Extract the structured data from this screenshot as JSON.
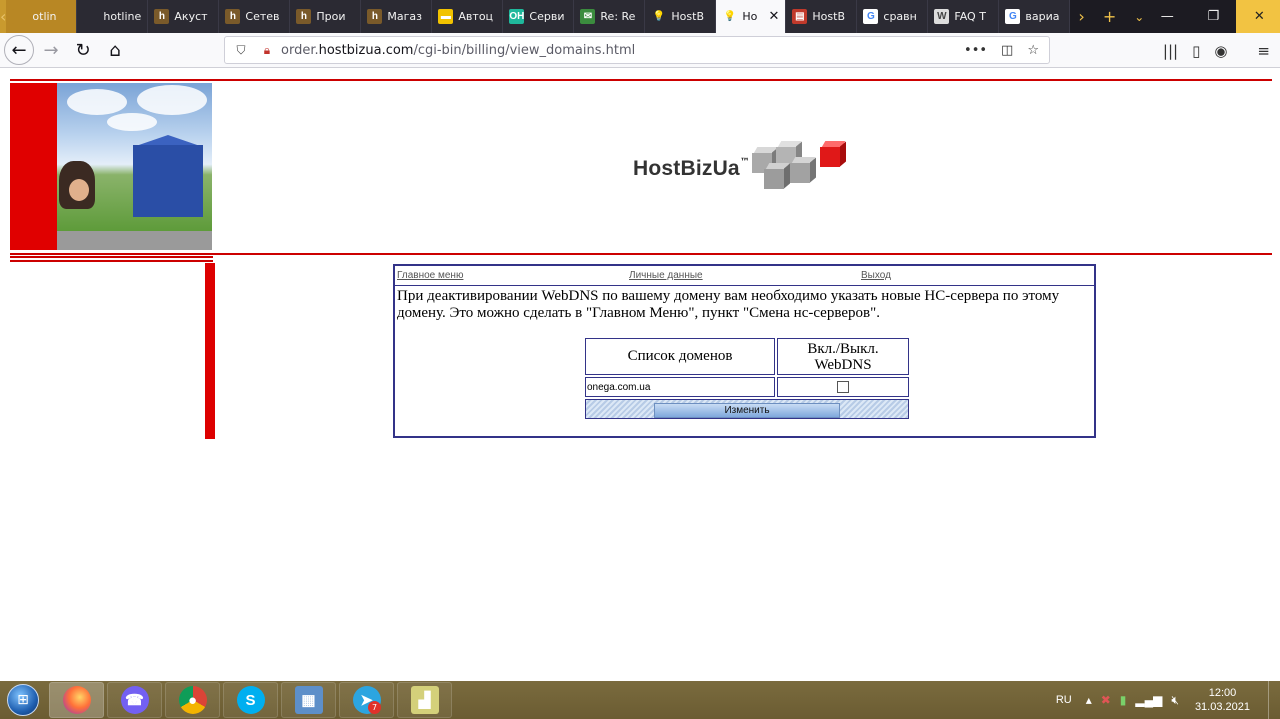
{
  "browser": {
    "tabs": [
      {
        "title": "otlin",
        "favicon": "page-icon",
        "favicon_text": "",
        "favicon_color": "#b88724",
        "style": "yellow"
      },
      {
        "title": "hotline.ua",
        "favicon": "page-icon",
        "favicon_text": "",
        "favicon_color": "#2b2a33",
        "style": "dark"
      },
      {
        "title": "Акуст",
        "favicon": "hotline-icon",
        "favicon_text": "h",
        "favicon_color": "#7a5a2a",
        "style": "dark"
      },
      {
        "title": "Сетев",
        "favicon": "hotline-icon",
        "favicon_text": "h",
        "favicon_color": "#7a5a2a",
        "style": "dark"
      },
      {
        "title": "Прои",
        "favicon": "hotline-icon",
        "favicon_text": "h",
        "favicon_color": "#7a5a2a",
        "style": "dark"
      },
      {
        "title": "Магаз",
        "favicon": "hotline-icon",
        "favicon_text": "h",
        "favicon_color": "#7a5a2a",
        "style": "dark"
      },
      {
        "title": "Автоц",
        "favicon": "auto-icon",
        "favicon_text": "▬",
        "favicon_color": "#f2c300",
        "style": "dark"
      },
      {
        "title": "Серви",
        "favicon": "service-icon",
        "favicon_text": "OH",
        "favicon_color": "#1fb89c",
        "style": "dark"
      },
      {
        "title": "Re: Re",
        "favicon": "mail-icon",
        "favicon_text": "✉",
        "favicon_color": "#3b8c3e",
        "style": "dark"
      },
      {
        "title": "HostB",
        "favicon": "bulb-icon",
        "favicon_text": "💡",
        "favicon_color": "transparent",
        "style": "dark"
      },
      {
        "title": "Ho",
        "favicon": "bulb-icon",
        "favicon_text": "💡",
        "favicon_color": "transparent",
        "style": "active"
      },
      {
        "title": "HostB",
        "favicon": "flag-icon",
        "favicon_text": "▤",
        "favicon_color": "#c0392b",
        "style": "dark"
      },
      {
        "title": "сравн",
        "favicon": "google-icon",
        "favicon_text": "G",
        "favicon_color": "#ffffff",
        "style": "dark"
      },
      {
        "title": "FAQ T",
        "favicon": "wordpress-icon",
        "favicon_text": "W",
        "favicon_color": "#dddddd",
        "style": "dark"
      },
      {
        "title": "вариа",
        "favicon": "google-icon",
        "favicon_text": "G",
        "favicon_color": "#ffffff",
        "style": "dark"
      }
    ],
    "url_host_prefix": "order.",
    "url_host": "hostbizua.com",
    "url_path": "/cgi-bin/billing/view_domains.html",
    "url_more": "•••"
  },
  "logo": {
    "text": "HostBizUa",
    "tm": "™"
  },
  "menu": {
    "main": "Главное меню",
    "personal": "Личные данные",
    "logout": "Выход"
  },
  "notice": "При деактивировании WebDNS по вашему домену вам необходимо указать новые НС-сервера по этому домену. Это можно сделать в \"Главном Меню\", пункт \"Смена нс-серверов\".",
  "table": {
    "col_domains": "Список доменов",
    "col_webdns_line1": "Вкл./Выкл.",
    "col_webdns_line2": "WebDNS",
    "rows": [
      {
        "domain": "onega.com.ua",
        "webdns_enabled": false
      }
    ],
    "submit": "Изменить"
  },
  "taskbar": {
    "apps": [
      {
        "name": "firefox",
        "icon": "firefox-icon",
        "label": "",
        "color": "#e66000",
        "active": true
      },
      {
        "name": "viber",
        "icon": "viber-icon",
        "label": "☎",
        "color": "#7360f2",
        "active": false
      },
      {
        "name": "chrome",
        "icon": "chrome-icon",
        "label": "●",
        "color": "#dd4b39",
        "active": false
      },
      {
        "name": "skype",
        "icon": "skype-icon",
        "label": "S",
        "color": "#00aff0",
        "active": false
      },
      {
        "name": "control-panel",
        "icon": "control-panel-icon",
        "label": "▦",
        "color": "#5d8fc9",
        "active": false
      },
      {
        "name": "telegram",
        "icon": "telegram-icon",
        "label": "➤",
        "color": "#2ca5e0",
        "active": false,
        "badge": "7"
      },
      {
        "name": "chart-app",
        "icon": "chart-icon",
        "label": "▟",
        "color": "#d4d07a",
        "active": false
      }
    ],
    "lang": "RU",
    "time": "12:00",
    "date": "31.03.2021"
  }
}
